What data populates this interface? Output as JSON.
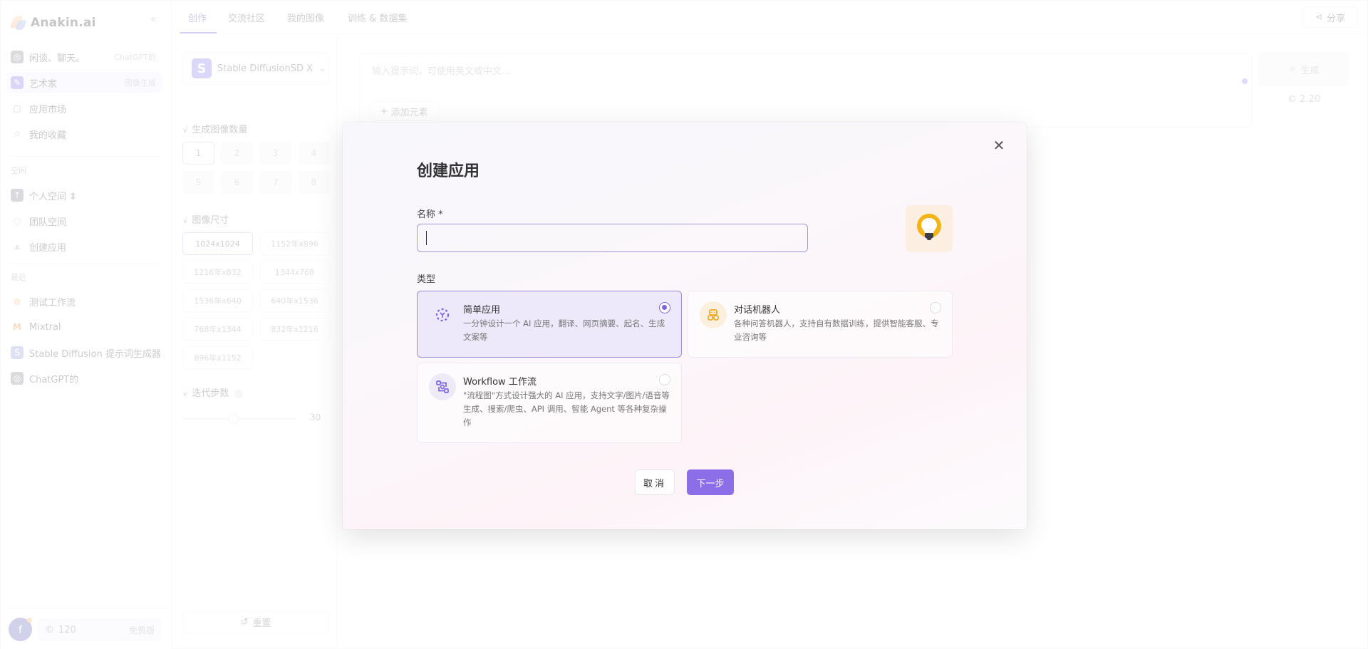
{
  "app": {
    "logo_text": "Anakin.ai",
    "collapse_icon": "double-chevron-left-icon"
  },
  "sidebar": {
    "items": [
      {
        "label": "闲谈、聊天。",
        "right": "ChatGPT的",
        "icon": "chatgpt-icon",
        "active": false
      },
      {
        "label": "艺术家",
        "right": "图像生成",
        "icon": "artist-icon",
        "active": true
      },
      {
        "label": "应用市场",
        "right": "",
        "icon": "store-icon",
        "active": false
      },
      {
        "label": "我的收藏",
        "right": "",
        "icon": "star-icon",
        "active": false
      }
    ],
    "space_section": "空间",
    "space_items": [
      {
        "label": "个人空间 ⇕",
        "icon": "personal-space-icon"
      },
      {
        "label": "团队空间",
        "icon": "planet-icon"
      },
      {
        "label": "创建应用",
        "icon": "compass-icon"
      }
    ],
    "recent_section": "最近",
    "recent_items": [
      {
        "label": "测试工作流",
        "icon": "bulb-icon"
      },
      {
        "label": "Mixtral",
        "icon": "mixtral-icon"
      },
      {
        "label": "Stable Diffusion 提示词生成器",
        "icon": "sd-icon"
      },
      {
        "label": "ChatGPT的",
        "icon": "chatgpt-icon"
      }
    ],
    "user": {
      "avatar_letter": "f",
      "credits": "120",
      "plan": "免费版"
    }
  },
  "topbar": {
    "tabs": [
      {
        "label": "创作",
        "active": true
      },
      {
        "label": "交流社区",
        "active": false
      },
      {
        "label": "我的图像",
        "active": false
      },
      {
        "label": "训练 & 数据集",
        "active": false
      }
    ],
    "share_label": "分享"
  },
  "leftpanel": {
    "model_name": "Stable DiffusionSD X",
    "count_heading": "生成图像数量",
    "counts": [
      "1",
      "2",
      "3",
      "4",
      "5",
      "6",
      "7",
      "8"
    ],
    "selected_count": "1",
    "size_heading": "图像尺寸",
    "sizes": [
      "1024x1024",
      "1152年x896",
      "1216年x832",
      "1344x768",
      "1536年x640",
      "640年x1536",
      "768年x1344",
      "832年x1216",
      "896年x1152"
    ],
    "selected_size": "1024x1024",
    "steps_heading": "迭代步数",
    "steps_value": "30",
    "steps_fraction": 0.45,
    "reset_label": "重置"
  },
  "prompt": {
    "placeholder": "输入提示词，可使用英文或中文...",
    "add_element_label": "添加元素",
    "generate_label": "生成",
    "cost": "2.20"
  },
  "modal": {
    "title": "创建应用",
    "name_label": "名称 *",
    "name_value": "",
    "type_label": "类型",
    "types": [
      {
        "title": "简单应用",
        "desc": "一分钟设计一个 AI 应用，翻译、网页摘要、起名、生成文案等",
        "icon": "simple-app-icon",
        "selected": true
      },
      {
        "title": "对话机器人",
        "desc": "各种问答机器人，支持自有数据训练，提供智能客服、专业咨询等",
        "icon": "robot-icon",
        "selected": false
      },
      {
        "title": "Workflow 工作流",
        "desc": "\"流程图\"方式设计强大的 AI 应用，支持文字/图片/语音等生成、搜索/爬虫、API 调用、智能 Agent 等各种复杂操作",
        "icon": "workflow-icon",
        "selected": false
      }
    ],
    "cancel_label": "取消",
    "next_label": "下一步",
    "colors": {
      "accent": "#8c6ee8",
      "selected_bg": "#ede9fb",
      "icon_bg": "#fcefe2",
      "bulb": "#f4b316"
    }
  }
}
